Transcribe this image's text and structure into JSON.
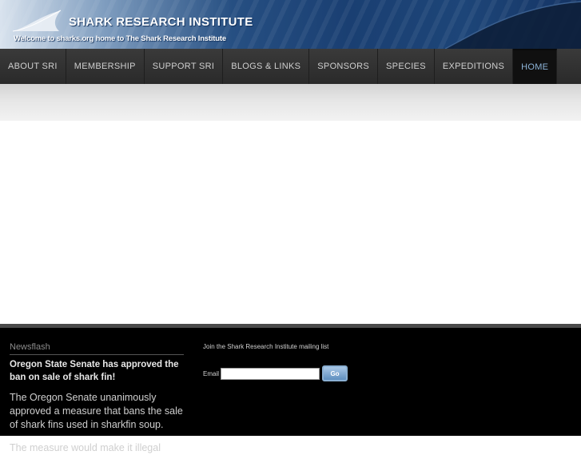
{
  "header": {
    "title": "SHARK RESEARCH INSTITUTE",
    "tagline": "Welcome to sharks.org home to The Shark Research Institute"
  },
  "nav": {
    "items": [
      {
        "label": "ABOUT SRI"
      },
      {
        "label": "MEMBERSHIP"
      },
      {
        "label": "SUPPORT SRI"
      },
      {
        "label": "BLOGS & LINKS"
      },
      {
        "label": "SPONSORS"
      },
      {
        "label": "SPECIES"
      },
      {
        "label": "EXPEDITIONS"
      },
      {
        "label": "HOME",
        "active": true
      }
    ]
  },
  "newsflash": {
    "heading": "Newsflash",
    "title": "Oregon State Senate has approved the ban on sale of shark fin!",
    "body": "The Oregon Senate unanimously approved a measure that bans the sale of shark fins used in sharkfin soup.",
    "more": "The measure would make it illegal"
  },
  "mailing": {
    "label": "Join the Shark Research Institute mailing list",
    "email_label": "Email",
    "email_value": "",
    "go_label": "Go"
  },
  "colors": {
    "nav_bg": "#2b2b2b",
    "nav_active_text": "#8db4d8",
    "footer_bg": "#000000",
    "header_blue": "#1a3f72"
  }
}
